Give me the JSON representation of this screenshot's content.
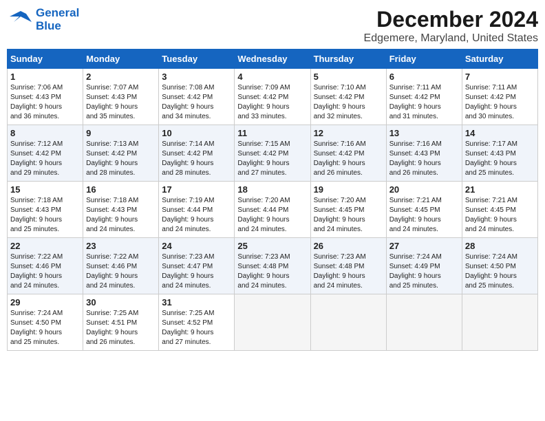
{
  "logo": {
    "line1": "General",
    "line2": "Blue"
  },
  "title": "December 2024",
  "subtitle": "Edgemere, Maryland, United States",
  "weekdays": [
    "Sunday",
    "Monday",
    "Tuesday",
    "Wednesday",
    "Thursday",
    "Friday",
    "Saturday"
  ],
  "weeks": [
    [
      {
        "day": "1",
        "info": "Sunrise: 7:06 AM\nSunset: 4:43 PM\nDaylight: 9 hours\nand 36 minutes."
      },
      {
        "day": "2",
        "info": "Sunrise: 7:07 AM\nSunset: 4:43 PM\nDaylight: 9 hours\nand 35 minutes."
      },
      {
        "day": "3",
        "info": "Sunrise: 7:08 AM\nSunset: 4:42 PM\nDaylight: 9 hours\nand 34 minutes."
      },
      {
        "day": "4",
        "info": "Sunrise: 7:09 AM\nSunset: 4:42 PM\nDaylight: 9 hours\nand 33 minutes."
      },
      {
        "day": "5",
        "info": "Sunrise: 7:10 AM\nSunset: 4:42 PM\nDaylight: 9 hours\nand 32 minutes."
      },
      {
        "day": "6",
        "info": "Sunrise: 7:11 AM\nSunset: 4:42 PM\nDaylight: 9 hours\nand 31 minutes."
      },
      {
        "day": "7",
        "info": "Sunrise: 7:11 AM\nSunset: 4:42 PM\nDaylight: 9 hours\nand 30 minutes."
      }
    ],
    [
      {
        "day": "8",
        "info": "Sunrise: 7:12 AM\nSunset: 4:42 PM\nDaylight: 9 hours\nand 29 minutes."
      },
      {
        "day": "9",
        "info": "Sunrise: 7:13 AM\nSunset: 4:42 PM\nDaylight: 9 hours\nand 28 minutes."
      },
      {
        "day": "10",
        "info": "Sunrise: 7:14 AM\nSunset: 4:42 PM\nDaylight: 9 hours\nand 28 minutes."
      },
      {
        "day": "11",
        "info": "Sunrise: 7:15 AM\nSunset: 4:42 PM\nDaylight: 9 hours\nand 27 minutes."
      },
      {
        "day": "12",
        "info": "Sunrise: 7:16 AM\nSunset: 4:42 PM\nDaylight: 9 hours\nand 26 minutes."
      },
      {
        "day": "13",
        "info": "Sunrise: 7:16 AM\nSunset: 4:43 PM\nDaylight: 9 hours\nand 26 minutes."
      },
      {
        "day": "14",
        "info": "Sunrise: 7:17 AM\nSunset: 4:43 PM\nDaylight: 9 hours\nand 25 minutes."
      }
    ],
    [
      {
        "day": "15",
        "info": "Sunrise: 7:18 AM\nSunset: 4:43 PM\nDaylight: 9 hours\nand 25 minutes."
      },
      {
        "day": "16",
        "info": "Sunrise: 7:18 AM\nSunset: 4:43 PM\nDaylight: 9 hours\nand 24 minutes."
      },
      {
        "day": "17",
        "info": "Sunrise: 7:19 AM\nSunset: 4:44 PM\nDaylight: 9 hours\nand 24 minutes."
      },
      {
        "day": "18",
        "info": "Sunrise: 7:20 AM\nSunset: 4:44 PM\nDaylight: 9 hours\nand 24 minutes."
      },
      {
        "day": "19",
        "info": "Sunrise: 7:20 AM\nSunset: 4:45 PM\nDaylight: 9 hours\nand 24 minutes."
      },
      {
        "day": "20",
        "info": "Sunrise: 7:21 AM\nSunset: 4:45 PM\nDaylight: 9 hours\nand 24 minutes."
      },
      {
        "day": "21",
        "info": "Sunrise: 7:21 AM\nSunset: 4:45 PM\nDaylight: 9 hours\nand 24 minutes."
      }
    ],
    [
      {
        "day": "22",
        "info": "Sunrise: 7:22 AM\nSunset: 4:46 PM\nDaylight: 9 hours\nand 24 minutes."
      },
      {
        "day": "23",
        "info": "Sunrise: 7:22 AM\nSunset: 4:46 PM\nDaylight: 9 hours\nand 24 minutes."
      },
      {
        "day": "24",
        "info": "Sunrise: 7:23 AM\nSunset: 4:47 PM\nDaylight: 9 hours\nand 24 minutes."
      },
      {
        "day": "25",
        "info": "Sunrise: 7:23 AM\nSunset: 4:48 PM\nDaylight: 9 hours\nand 24 minutes."
      },
      {
        "day": "26",
        "info": "Sunrise: 7:23 AM\nSunset: 4:48 PM\nDaylight: 9 hours\nand 24 minutes."
      },
      {
        "day": "27",
        "info": "Sunrise: 7:24 AM\nSunset: 4:49 PM\nDaylight: 9 hours\nand 25 minutes."
      },
      {
        "day": "28",
        "info": "Sunrise: 7:24 AM\nSunset: 4:50 PM\nDaylight: 9 hours\nand 25 minutes."
      }
    ],
    [
      {
        "day": "29",
        "info": "Sunrise: 7:24 AM\nSunset: 4:50 PM\nDaylight: 9 hours\nand 25 minutes."
      },
      {
        "day": "30",
        "info": "Sunrise: 7:25 AM\nSunset: 4:51 PM\nDaylight: 9 hours\nand 26 minutes."
      },
      {
        "day": "31",
        "info": "Sunrise: 7:25 AM\nSunset: 4:52 PM\nDaylight: 9 hours\nand 27 minutes."
      },
      {
        "day": "",
        "info": ""
      },
      {
        "day": "",
        "info": ""
      },
      {
        "day": "",
        "info": ""
      },
      {
        "day": "",
        "info": ""
      }
    ]
  ]
}
